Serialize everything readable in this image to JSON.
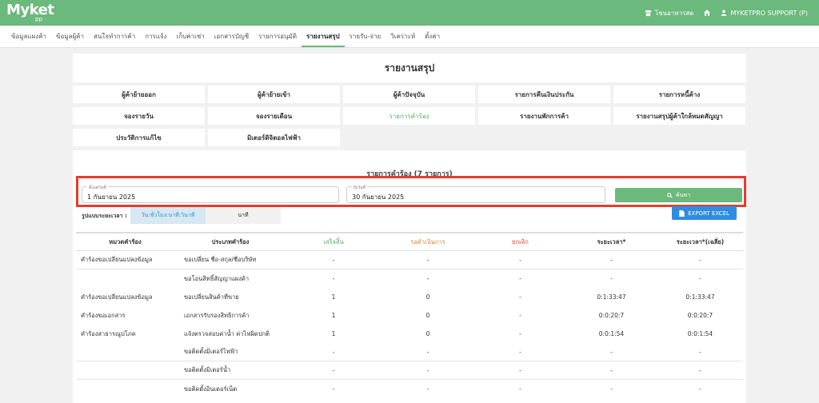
{
  "app": {
    "logo": "Myket",
    "logo_sub": "pp",
    "shop": "โชนอาหารสด",
    "user": "MYKETPRO SUPPORT (P)"
  },
  "nav": [
    "ข้อมูลแผงค้า",
    "ข้อมูลผู้ค้า",
    "สนใจทำการค้า",
    "การแจ้ง",
    "เก็บค่าเช่า",
    "เอกสารบัญชี",
    "รายการอนุมัติ",
    "รายงานสรุป",
    "รายรับ-จ่าย",
    "วิเคราะห์",
    "ตั้งค่า"
  ],
  "page_title": "รายงานสรุป",
  "report_buttons": [
    "ผู้ค้าย้ายออก",
    "ผู้ค้าย้ายเข้า",
    "ผู้ค้าปัจจุบัน",
    "รายการคืนเงินประกัน",
    "รายการหนี้ค้าง",
    "จองรายวัน",
    "จองรายเดือน",
    "รายการคำร้อง",
    "รายงานพักการค้า",
    "รายงานสรุปผู้ค้าใกล้หมดสัญญา",
    "ประวัติการแก้ไข",
    "มิเตอร์ดิจิตอลไฟฟ้า"
  ],
  "section_title": "รายการคำร้อง (7 รายการ)",
  "filter": {
    "from_label": "ตั้งแต่วันที่",
    "from_value": "1 กันยายน 2025",
    "to_label": "ถึงวันที่",
    "to_value": "30 กันยายน 2025",
    "search_label": "ค้นหา"
  },
  "format": {
    "label": "รูปแบบระยะเวลา :",
    "option_a": "วัน:ชั่วโมง:นาที:วินาที",
    "option_b": "นาที"
  },
  "export_label": "EXPORT EXCEL",
  "colors": {
    "green": "#6bb97c",
    "done": "#5aaa6b",
    "pending": "#d08b2d",
    "cancel": "#d9453b",
    "highlight": "#e53d2e",
    "blue": "#2f8de0"
  },
  "table": {
    "headers": [
      "หมวดคำร้อง",
      "ประเภทคำร้อง",
      "เสร็จสิ้น",
      "รอดำเนินการ",
      "ยกเลิก",
      "ระยะเวลา*",
      "ระยะเวลา*(เฉลี่ย)"
    ],
    "rows": [
      [
        "คำร้องขอเปลี่ยนแปลงข้อมูล",
        "ขอเปลี่ยน ชื่อ-สกุล/ชื่อบริษัท",
        "-",
        "-",
        "-",
        "-",
        "-"
      ],
      [
        "",
        "ขอโอนสิทธิ์สัญญาแผงค้า",
        "-",
        "-",
        "-",
        "-",
        "-"
      ],
      [
        "คำร้องขอเปลี่ยนแปลงข้อมูล",
        "ขอเปลี่ยนสินค้าที่ขาย",
        "1",
        "0",
        "-",
        "0:1:33:47",
        "0:1:33:47"
      ],
      [
        "คำร้องขอเอกสาร",
        "เอกสารรับรองสิทธิการค้า",
        "1",
        "0",
        "-",
        "0:0:20:7",
        "0:0:20:7"
      ],
      [
        "คำร้องสาธารณูปโภค",
        "แจ้งตรวจสอบค่าน้ำ ค่าไฟผิดปกติ",
        "1",
        "0",
        "-",
        "0:0:1:54",
        "0:0:1:54"
      ],
      [
        "",
        "ขอติดตั้งมิเตอร์ไฟฟ้า",
        "-",
        "-",
        "-",
        "-",
        "-"
      ],
      [
        "",
        "ขอติดตั้งมิเตอร์น้ำ",
        "-",
        "-",
        "-",
        "-",
        "-"
      ],
      [
        "",
        "ขอติดตั้งอินเตอร์เน็ต",
        "-",
        "-",
        "-",
        "-",
        "-"
      ]
    ]
  }
}
